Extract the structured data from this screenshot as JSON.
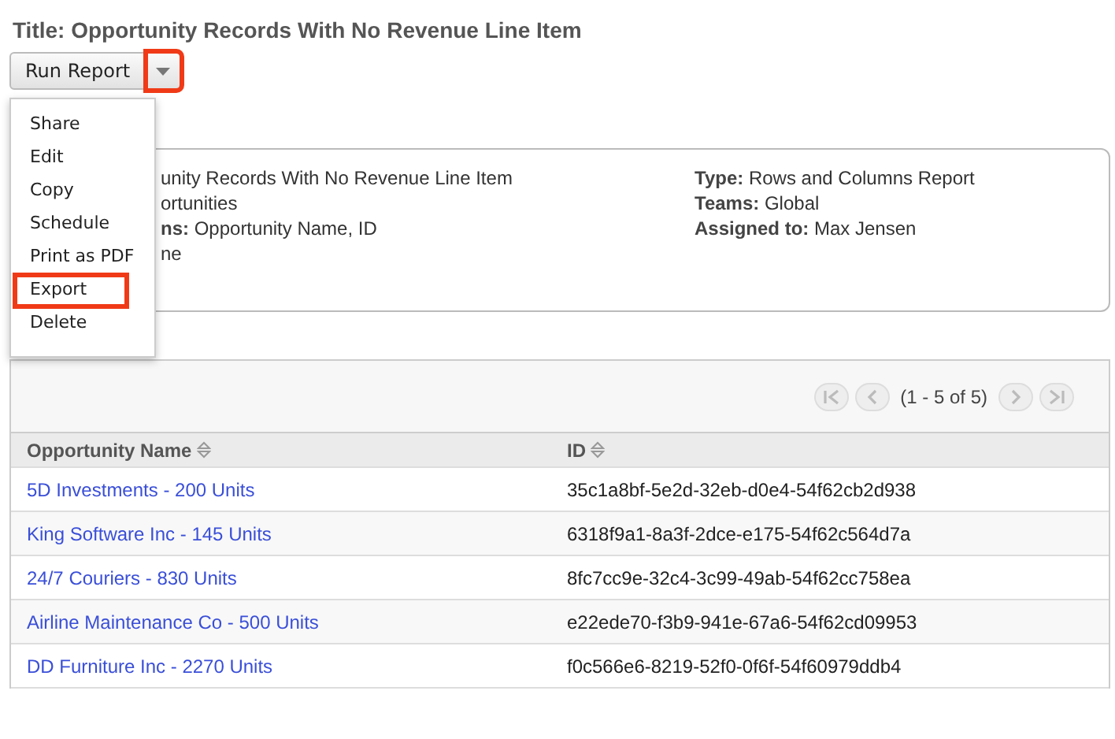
{
  "title": "Title: Opportunity Records With No Revenue Line Item",
  "actions": {
    "button": "Run Report",
    "caret_highlighted": true,
    "menu": [
      {
        "label": "Share",
        "highlighted": false
      },
      {
        "label": "Edit",
        "highlighted": false
      },
      {
        "label": "Copy",
        "highlighted": false
      },
      {
        "label": "Schedule",
        "highlighted": false
      },
      {
        "label": "Print as PDF",
        "highlighted": false
      },
      {
        "label": "Export",
        "highlighted": true
      },
      {
        "label": "Delete",
        "highlighted": false
      }
    ]
  },
  "details": {
    "left": [
      "unity Records With No Revenue Line Item",
      "ortunities",
      "**ns:** Opportunity Name, ID",
      "ne"
    ],
    "right": [
      "**Type:** Rows and Columns Report",
      "**Teams:** Global",
      "**Assigned to:** Max Jensen"
    ]
  },
  "table": {
    "pager": {
      "text": "(1 - 5 of 5)",
      "disabled": true
    },
    "columns": [
      "Opportunity Name",
      "ID"
    ],
    "rows": [
      [
        "5D Investments - 200 Units",
        "35c1a8bf-5e2d-32eb-d0e4-54f62cb2d938"
      ],
      [
        "King Software Inc - 145 Units",
        "6318f9a1-8a3f-2dce-e175-54f62c564d7a"
      ],
      [
        "24/7 Couriers - 830 Units",
        "8fc7cc9e-32c4-3c99-49ab-54f62cc758ea"
      ],
      [
        "Airline Maintenance Co - 500 Units",
        "e22ede70-f3b9-941e-67a6-54f62cd09953"
      ],
      [
        "DD Furniture Inc - 2270 Units",
        "f0c566e6-8219-52f0-0f6f-54f60979ddb4"
      ]
    ]
  }
}
